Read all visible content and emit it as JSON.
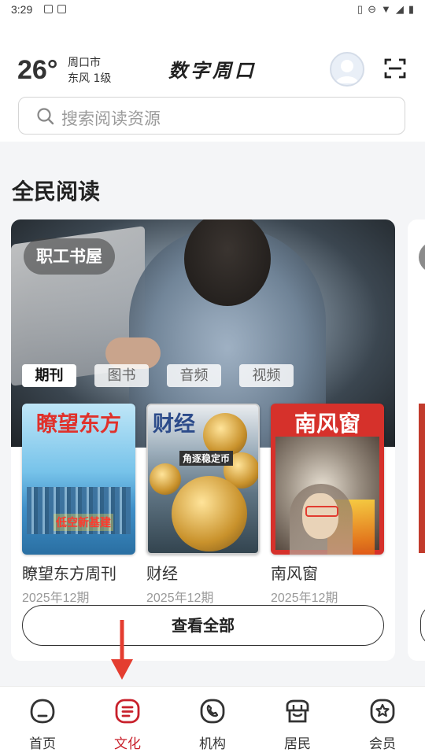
{
  "status_bar": {
    "time": "3:29",
    "icons": [
      "image-icon",
      "a-icon",
      "vibrate-icon",
      "dnd-icon",
      "wifi-icon",
      "signal-icon",
      "battery-icon"
    ]
  },
  "header": {
    "temperature": "26°",
    "city": "周口市",
    "wind": "东风 1级",
    "app_title": "数字周口"
  },
  "search": {
    "placeholder": "搜索阅读资源"
  },
  "section": {
    "title": "全民阅读"
  },
  "card": {
    "badge": "职工书屋",
    "tabs": [
      {
        "label": "期刊",
        "active": true
      },
      {
        "label": "图书",
        "active": false
      },
      {
        "label": "音频",
        "active": false
      },
      {
        "label": "视频",
        "active": false
      }
    ],
    "books": [
      {
        "title": "瞭望东方周刊",
        "date": "2025年12期",
        "cover_title": "瞭望东方",
        "cover_tag": "低空新基建"
      },
      {
        "title": "财经",
        "date": "2025年12期",
        "cover_title": "财经",
        "cover_tag": "角逐稳定币"
      },
      {
        "title": "南风窗",
        "date": "2025年12期",
        "cover_title": "南风窗"
      }
    ],
    "view_all": "查看全部"
  },
  "bottom_nav": [
    {
      "label": "首页",
      "icon": "home-icon",
      "active": false
    },
    {
      "label": "文化",
      "icon": "culture-icon",
      "active": true
    },
    {
      "label": "机构",
      "icon": "phone-icon",
      "active": false
    },
    {
      "label": "居民",
      "icon": "residents-icon",
      "active": false
    },
    {
      "label": "会员",
      "icon": "member-star-icon",
      "active": false
    }
  ],
  "colors": {
    "accent": "#c8202b",
    "background": "#f4f5f7",
    "annotation_arrow": "#e43d30"
  }
}
